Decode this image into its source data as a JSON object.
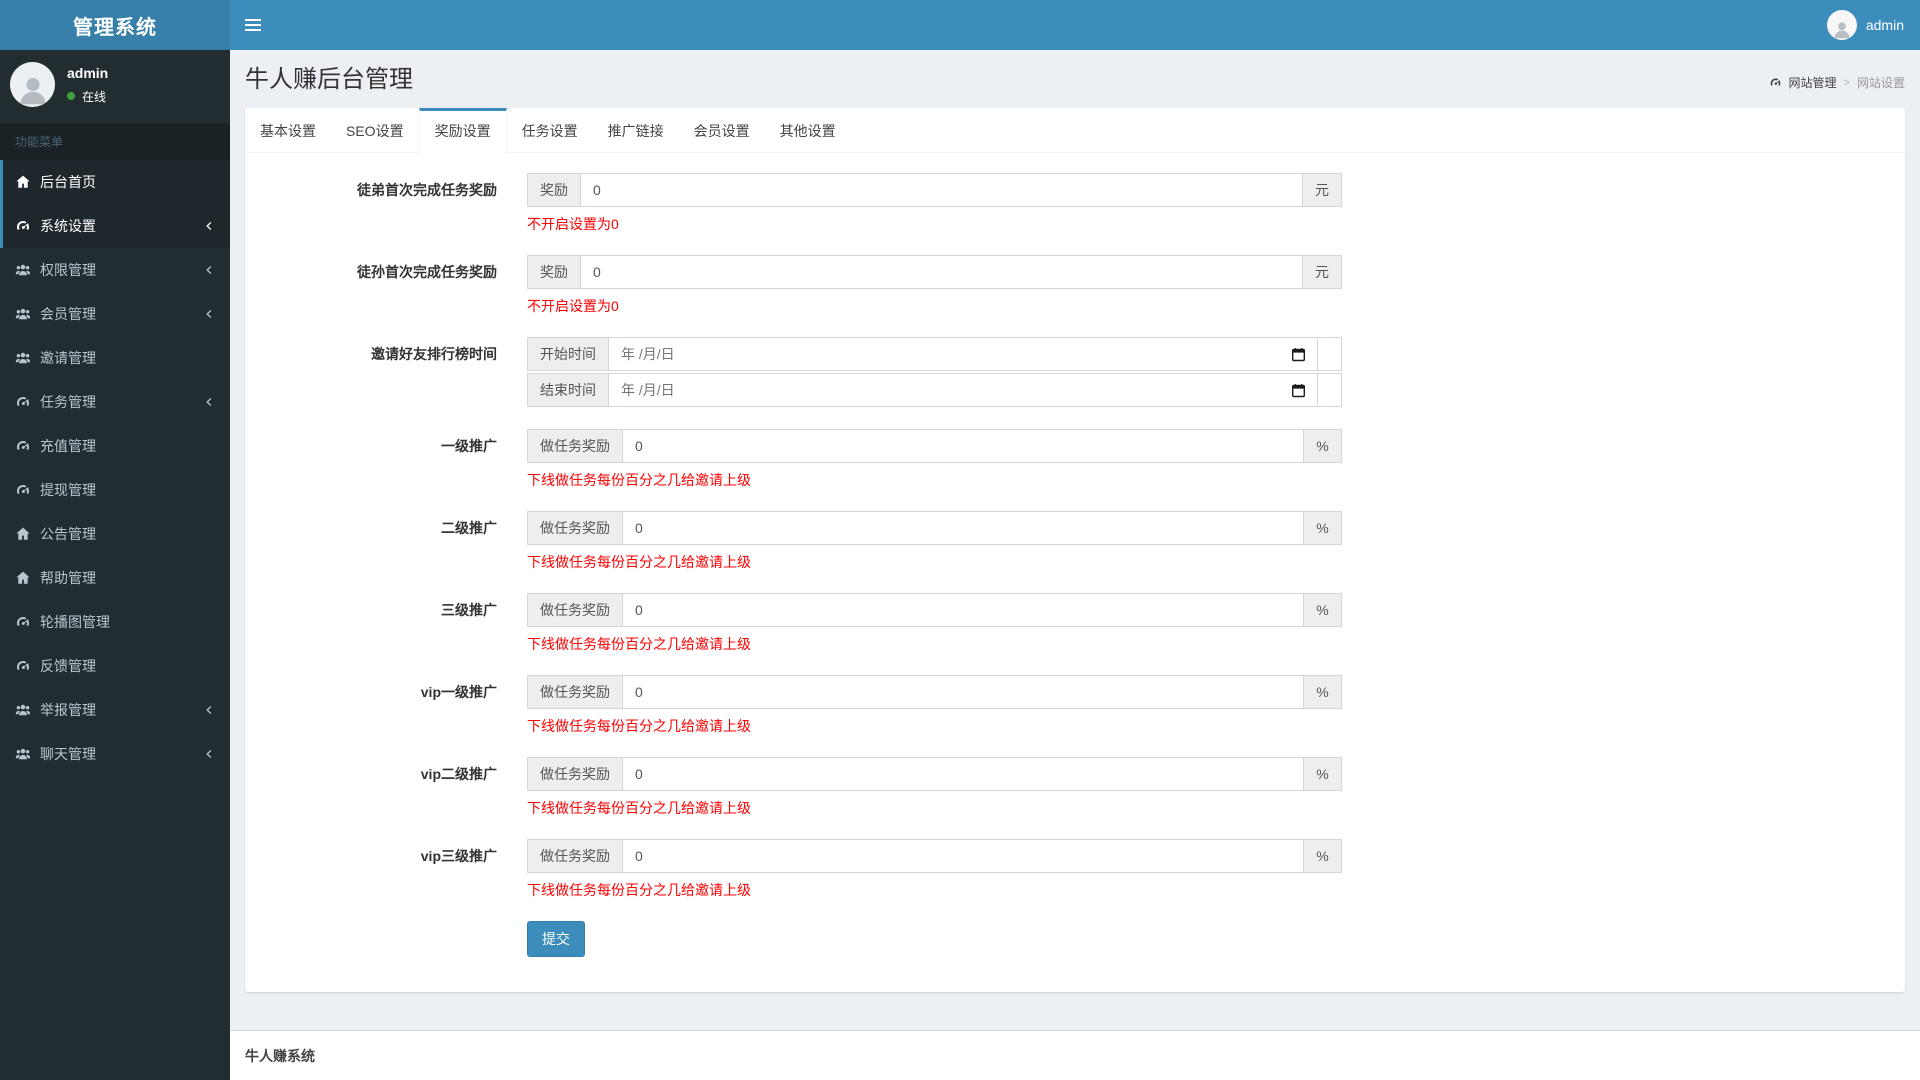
{
  "app": {
    "brand": "管理系统"
  },
  "navbar": {
    "user_name": "admin"
  },
  "sidebar": {
    "user": {
      "name": "admin",
      "status": "在线"
    },
    "menu_header": "功能菜单",
    "items": [
      {
        "label": "后台首页",
        "icon": "home-icon",
        "active": true,
        "has_submenu": false
      },
      {
        "label": "系统设置",
        "icon": "tachometer-icon",
        "active": true,
        "has_submenu": true
      },
      {
        "label": "权限管理",
        "icon": "users-icon",
        "active": false,
        "has_submenu": true
      },
      {
        "label": "会员管理",
        "icon": "users-icon",
        "active": false,
        "has_submenu": true
      },
      {
        "label": "邀请管理",
        "icon": "users-icon",
        "active": false,
        "has_submenu": false
      },
      {
        "label": "任务管理",
        "icon": "tachometer-icon",
        "active": false,
        "has_submenu": true
      },
      {
        "label": "充值管理",
        "icon": "tachometer-icon",
        "active": false,
        "has_submenu": false
      },
      {
        "label": "提现管理",
        "icon": "tachometer-icon",
        "active": false,
        "has_submenu": false
      },
      {
        "label": "公告管理",
        "icon": "home-icon",
        "active": false,
        "has_submenu": false
      },
      {
        "label": "帮助管理",
        "icon": "home-icon",
        "active": false,
        "has_submenu": false
      },
      {
        "label": "轮播图管理",
        "icon": "tachometer-icon",
        "active": false,
        "has_submenu": false
      },
      {
        "label": "反馈管理",
        "icon": "tachometer-icon",
        "active": false,
        "has_submenu": false
      },
      {
        "label": "举报管理",
        "icon": "users-icon",
        "active": false,
        "has_submenu": true
      },
      {
        "label": "聊天管理",
        "icon": "users-icon",
        "active": false,
        "has_submenu": true
      }
    ]
  },
  "page": {
    "title": "牛人赚后台管理",
    "breadcrumb": {
      "icon": "dashboard-icon",
      "parent": "网站管理",
      "separator": ">",
      "current": "网站设置"
    }
  },
  "tabs": [
    {
      "label": "基本设置",
      "active": false
    },
    {
      "label": "SEO设置",
      "active": false
    },
    {
      "label": "奖励设置",
      "active": true
    },
    {
      "label": "任务设置",
      "active": false
    },
    {
      "label": "推广链接",
      "active": false
    },
    {
      "label": "会员设置",
      "active": false
    },
    {
      "label": "其他设置",
      "active": false
    }
  ],
  "form": {
    "rows": [
      {
        "type": "text",
        "label": "徒弟首次完成任务奖励",
        "addon": "奖励",
        "value": "0",
        "suffix": "元",
        "hint": "不开启设置为0"
      },
      {
        "type": "text",
        "label": "徒孙首次完成任务奖励",
        "addon": "奖励",
        "value": "0",
        "suffix": "元",
        "hint": "不开启设置为0"
      },
      {
        "type": "dates",
        "label": "邀请好友排行榜时间",
        "date_rows": [
          {
            "addon": "开始时间",
            "placeholder": "年 /月/日"
          },
          {
            "addon": "结束时间",
            "placeholder": "年 /月/日"
          }
        ]
      },
      {
        "type": "text",
        "label": "一级推广",
        "addon": "做任务奖励",
        "value": "0",
        "suffix": "%",
        "hint": "下线做任务每份百分之几给邀请上级"
      },
      {
        "type": "text",
        "label": "二级推广",
        "addon": "做任务奖励",
        "value": "0",
        "suffix": "%",
        "hint": "下线做任务每份百分之几给邀请上级"
      },
      {
        "type": "text",
        "label": "三级推广",
        "addon": "做任务奖励",
        "value": "0",
        "suffix": "%",
        "hint": "下线做任务每份百分之几给邀请上级"
      },
      {
        "type": "text",
        "label": "vip一级推广",
        "addon": "做任务奖励",
        "value": "0",
        "suffix": "%",
        "hint": "下线做任务每份百分之几给邀请上级"
      },
      {
        "type": "text",
        "label": "vip二级推广",
        "addon": "做任务奖励",
        "value": "0",
        "suffix": "%",
        "hint": "下线做任务每份百分之几给邀请上级"
      },
      {
        "type": "text",
        "label": "vip三级推广",
        "addon": "做任务奖励",
        "value": "0",
        "suffix": "%",
        "hint": "下线做任务每份百分之几给邀请上级"
      }
    ],
    "submit_label": "提交"
  },
  "footer": {
    "text": "牛人赚系统"
  },
  "colors": {
    "accent": "#3c8dbc",
    "logo_bg": "#367fa9",
    "sidebar_bg": "#222d32",
    "error": "#ff0000",
    "body_bg": "#ecf0f5"
  }
}
